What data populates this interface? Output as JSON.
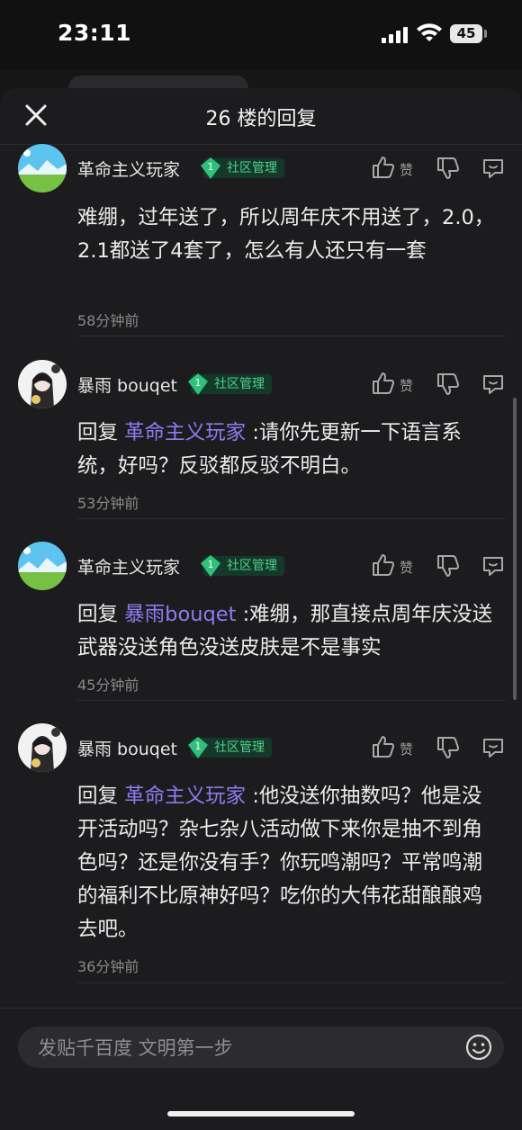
{
  "status_bar": {
    "time": "23:11",
    "battery": "45"
  },
  "sheet": {
    "title": "26 楼的回复"
  },
  "zan_label": "赞",
  "comments": [
    {
      "user": "革命主义玩家",
      "badge_level": "1",
      "badge_label": "社区管理",
      "prefix": "",
      "mention": "",
      "text": "难绷，过年送了，所以周年庆不用送了，2.0，2.1都送了4套了，怎么有人还只有一套",
      "time": "58分钟前"
    },
    {
      "user": "暴雨 bouqet",
      "badge_level": "1",
      "badge_label": "社区管理",
      "prefix": "回复 ",
      "mention": "革命主义玩家",
      "text": " :请你先更新一下语言系统，好吗？反驳都反驳不明白。",
      "time": "53分钟前"
    },
    {
      "user": "革命主义玩家",
      "badge_level": "1",
      "badge_label": "社区管理",
      "prefix": "回复 ",
      "mention": "暴雨bouqet",
      "text": " :难绷，那直接点周年庆没送武器没送角色没送皮肤是不是事实",
      "time": "45分钟前"
    },
    {
      "user": "暴雨 bouqet",
      "badge_level": "1",
      "badge_label": "社区管理",
      "prefix": "回复 ",
      "mention": "革命主义玩家",
      "text": " :他没送你抽数吗？他是没开活动吗？杂七杂八活动做下来你是抽不到角色吗？还是你没有手？你玩鸣潮吗？平常鸣潮的福利不比原神好吗？吃你的大伟花甜酿酿鸡去吧。",
      "time": "36分钟前"
    }
  ],
  "composer": {
    "placeholder": "发贴千百度 文明第一步"
  },
  "colors": {
    "accent_mention": "#8c7cf0",
    "badge_green": "#4fd08a",
    "background": "#1c1c1e"
  }
}
